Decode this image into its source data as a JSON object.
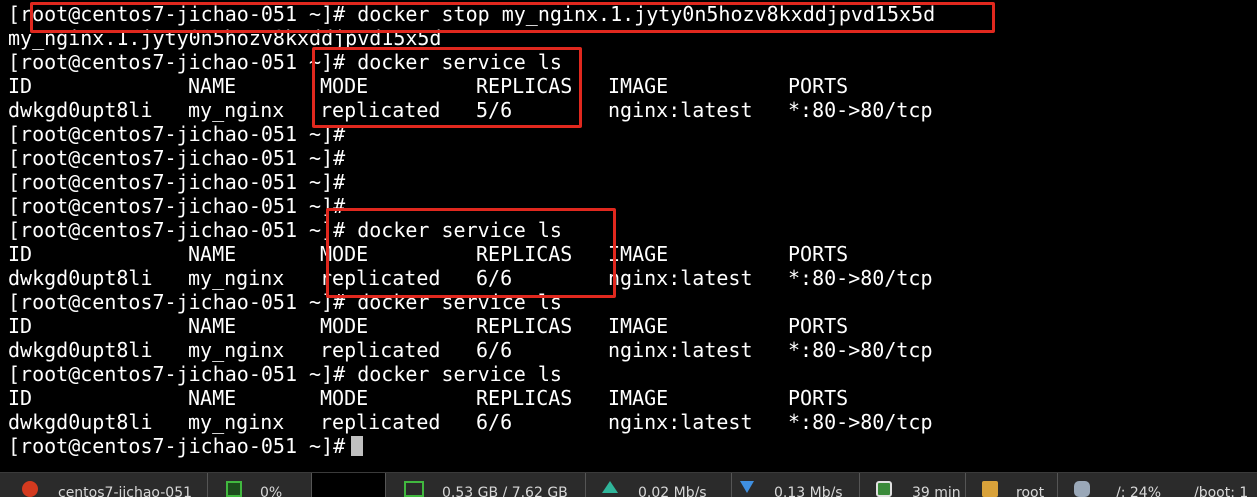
{
  "terminal": {
    "lines": [
      {
        "type": "cmd",
        "prompt": "[root@centos7-jichao-051 ~]#",
        "command": "docker stop my_nginx.1.jyty0n5hozv8kxddjpvd15x5d"
      },
      {
        "type": "out",
        "text": "my_nginx.1.jyty0n5hozv8kxddjpvd15x5d"
      },
      {
        "type": "cmd",
        "prompt": "[root@centos7-jichao-051 ~]#",
        "command": "docker service ls"
      },
      {
        "type": "row",
        "cols": [
          "ID",
          "NAME",
          "MODE",
          "REPLICAS",
          "IMAGE",
          "PORTS"
        ]
      },
      {
        "type": "row",
        "cols": [
          "dwkgd0upt8li",
          "my_nginx",
          "replicated",
          "5/6",
          "nginx:latest",
          "*:80->80/tcp"
        ]
      },
      {
        "type": "cmd",
        "prompt": "[root@centos7-jichao-051 ~]#",
        "command": ""
      },
      {
        "type": "cmd",
        "prompt": "[root@centos7-jichao-051 ~]#",
        "command": ""
      },
      {
        "type": "cmd",
        "prompt": "[root@centos7-jichao-051 ~]#",
        "command": ""
      },
      {
        "type": "cmd",
        "prompt": "[root@centos7-jichao-051 ~]#",
        "command": ""
      },
      {
        "type": "cmd",
        "prompt": "[root@centos7-jichao-051 ~]#",
        "command": "docker service ls"
      },
      {
        "type": "row",
        "cols": [
          "ID",
          "NAME",
          "MODE",
          "REPLICAS",
          "IMAGE",
          "PORTS"
        ]
      },
      {
        "type": "row",
        "cols": [
          "dwkgd0upt8li",
          "my_nginx",
          "replicated",
          "6/6",
          "nginx:latest",
          "*:80->80/tcp"
        ]
      },
      {
        "type": "cmd",
        "prompt": "[root@centos7-jichao-051 ~]#",
        "command": "docker service ls"
      },
      {
        "type": "row",
        "cols": [
          "ID",
          "NAME",
          "MODE",
          "REPLICAS",
          "IMAGE",
          "PORTS"
        ]
      },
      {
        "type": "row",
        "cols": [
          "dwkgd0upt8li",
          "my_nginx",
          "replicated",
          "6/6",
          "nginx:latest",
          "*:80->80/tcp"
        ]
      },
      {
        "type": "cmd",
        "prompt": "[root@centos7-jichao-051 ~]#",
        "command": "docker service ls"
      },
      {
        "type": "row",
        "cols": [
          "ID",
          "NAME",
          "MODE",
          "REPLICAS",
          "IMAGE",
          "PORTS"
        ]
      },
      {
        "type": "row",
        "cols": [
          "dwkgd0upt8li",
          "my_nginx",
          "replicated",
          "6/6",
          "nginx:latest",
          "*:80->80/tcp"
        ]
      },
      {
        "type": "cmd",
        "prompt": "[root@centos7-jichao-051 ~]#",
        "command": "",
        "cursor": true
      }
    ],
    "highlight_color": "#e0281e"
  },
  "statusbar": {
    "host": "centos7-jichao-051",
    "cpu": "0%",
    "memory": "0.53 GB / 7.62 GB",
    "upload": "0.02 Mb/s",
    "download": "0.13 Mb/s",
    "uptime": "39 min",
    "user": "root",
    "disk": "/: 24%",
    "disk2": "/boot: 1"
  }
}
